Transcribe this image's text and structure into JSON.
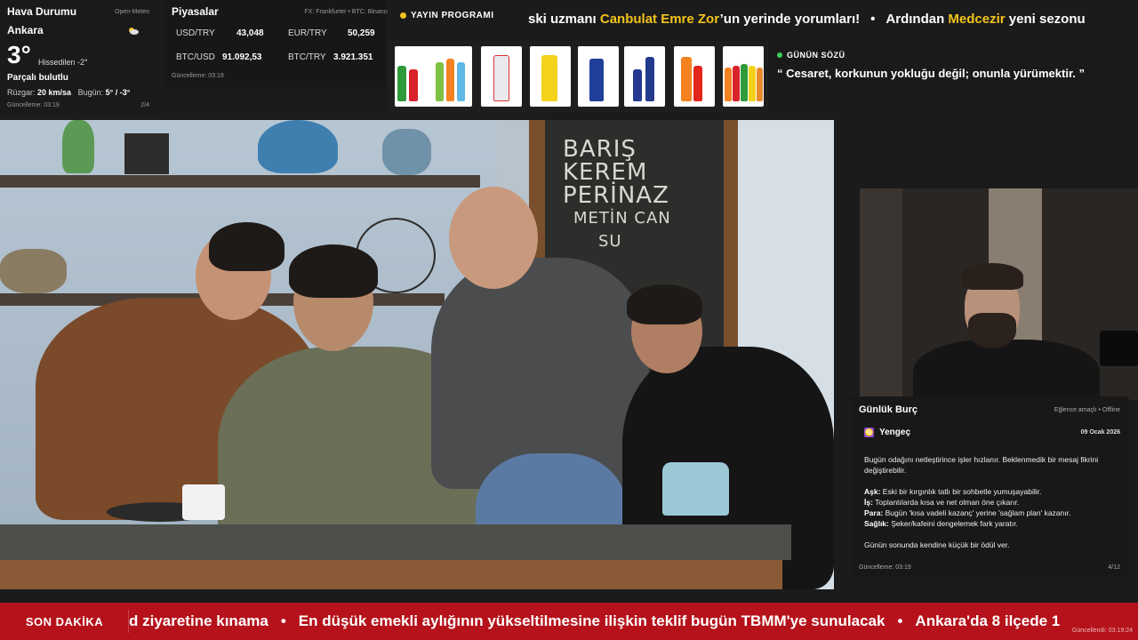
{
  "weather": {
    "title": "Hava Durumu",
    "source": "Open-Meteo",
    "city": "Ankara",
    "temp": "3°",
    "feels_like": "Hissedilen -2°",
    "condition": "Parçalı bulutlu",
    "wind_label": "Rüzgar:",
    "wind_value": "20 km/sa",
    "today_label": "Bugün:",
    "today_value": "5° / -3°",
    "updated": "Güncelleme: 03:19",
    "page": "2/4",
    "icon": "partly-cloudy-icon"
  },
  "markets": {
    "title": "Piyasalar",
    "source": "FX: Frankfurter • BTC: Binance",
    "rows": [
      {
        "key": "USD/TRY",
        "value": "43,048"
      },
      {
        "key": "EUR/TRY",
        "value": "50,259"
      },
      {
        "key": "BTC/USD",
        "value": "91.092,53"
      },
      {
        "key": "BTC/TRY",
        "value": "3.921.351"
      }
    ],
    "updated": "Güncelleme: 03:19"
  },
  "top_ticker": {
    "label": "YAYIN PROGRAMI",
    "parts": [
      {
        "text": "ski uzmanı ",
        "hl": false
      },
      {
        "text": "Canbulat Emre Zor",
        "hl": true
      },
      {
        "text": "’un yerinde yorumları!",
        "hl": false
      },
      {
        "text": "•",
        "hl": false,
        "sep": true
      },
      {
        "text": "Ardından ",
        "hl": false
      },
      {
        "text": "Medcezir",
        "hl": true
      },
      {
        "text": " yeni sezonu",
        "hl": false
      }
    ],
    "accent": "#f2c31b"
  },
  "quote": {
    "title": "GÜNÜN SÖZÜ",
    "text": "“ Cesaret, korkunun yokluğu değil; onunla yürümektir. ”"
  },
  "video": {
    "chalkboard": [
      "BARIŞ",
      "KEREM",
      "PERİNAZ",
      "METİN CAN",
      "SU"
    ]
  },
  "horoscope": {
    "title": "Günlük Burç",
    "source": "Eğlence amaçlı • Offline",
    "sign": "Yengeç",
    "date": "09 Ocak 2026",
    "intro": "Bugün odağını netleştirince işler hızlanır. Beklenmedik bir mesaj fikrini değiştirebilir.",
    "lines": [
      {
        "k": "Aşk:",
        "v": " Eski bir kırgınlık tatlı bir sohbetle yumuşayabilir."
      },
      {
        "k": "İş:",
        "v": " Toplantılarda kısa ve net olman öne çıkarır."
      },
      {
        "k": "Para:",
        "v": " Bugün 'kısa vadeli kazanç' yerine 'sağlam plan' kazanır."
      },
      {
        "k": "Sağlık:",
        "v": " Şeker/kafeini dengelemek fark yaratır."
      }
    ],
    "closing": "Günün sonunda kendine küçük bir ödül ver.",
    "updated": "Güncelleme: 03:19",
    "page": "4/12"
  },
  "breaking": {
    "label": "SON DAKİKA",
    "items": [
      "d ziyaretine kınama",
      "En düşük emekli aylığının yükseltilmesine ilişkin teklif bugün TBMM'ye sunulacak",
      "Ankara'da 8 ilçede 1"
    ],
    "updated": "Güncellendi: 03:19:24",
    "color": "#b5121b"
  }
}
